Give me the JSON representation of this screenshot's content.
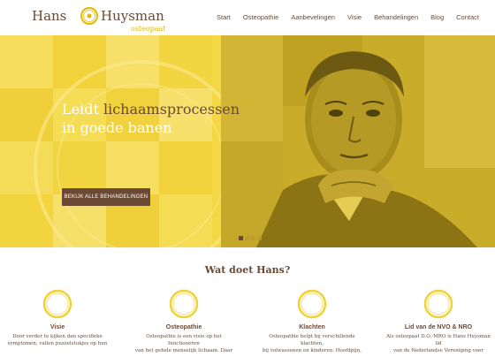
{
  "logo": {
    "first": "Hans",
    "last": "Huysman",
    "sub": "osteopaat"
  },
  "nav": {
    "items": [
      "Start",
      "Osteopathie",
      "Aanbevelingen",
      "Visie",
      "Behandelingen",
      "Blog",
      "Contact"
    ]
  },
  "hero": {
    "title_line1_a": "Leidt ",
    "title_line1_b": "lichaamsprocessen",
    "title_line2": "in goede banen",
    "cta": "BEKIJK ALLE BEHANDELINGEN",
    "slides_total": 4,
    "slide_active": 1
  },
  "section": {
    "title": "Wat doet Hans?",
    "columns": [
      {
        "title": "Visie",
        "text_l1": "Door verder te kijken dan specifieke",
        "text_l2": "symptomen, vallen puzzelstukjes op hun"
      },
      {
        "title": "Osteopathie",
        "text_l1": "Osteopathie is een visie op het functioneren",
        "text_l2": "van het gehele menselijk lichaam. Daar"
      },
      {
        "title": "Klachten",
        "text_l1": "Osteopathie helpt bij verschillende klachten,",
        "text_l2": "bij volwassenen en kinderen. Hoofdpijn,"
      },
      {
        "title": "Lid van de NVO & NRO",
        "text_l1": "Als osteopaat D.O.-MRO is Hans Huysman lid",
        "text_l2": "van de Nederlandse Vereniging voor"
      }
    ]
  },
  "colors": {
    "brown": "#6b4a35",
    "yellow": "#f3d743",
    "accent": "#e6b800"
  }
}
